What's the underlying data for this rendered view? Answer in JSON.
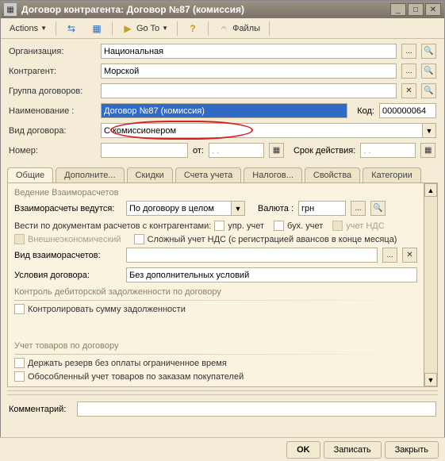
{
  "window": {
    "title": "Договор контрагента: Договор №87 (комиссия)"
  },
  "toolbar": {
    "actions": "Actions",
    "goto": "Go To",
    "files": "Файлы"
  },
  "form": {
    "org_label": "Организация:",
    "org_value": "Национальная",
    "counterparty_label": "Контрагент:",
    "counterparty_value": "Морской",
    "group_label": "Группа договоров:",
    "group_value": "",
    "name_label": "Наименование :",
    "name_value": "Договор №87 (комиссия)",
    "code_label": "Код:",
    "code_value": "000000064",
    "type_label": "Вид договора:",
    "type_value": "С комиссионером",
    "number_label": "Номер:",
    "number_value": "",
    "from_label": "от:",
    "from_value": ". .    ",
    "validity_label": "Срок действия:",
    "validity_value": ". .    "
  },
  "tabs": {
    "t1": "Общие",
    "t2": "Дополните...",
    "t3": "Скидки",
    "t4": "Счета учета",
    "t5": "Налогов...",
    "t6": "Свойства",
    "t7": "Категории"
  },
  "general": {
    "sec1": "ведение взаиморасчетов",
    "mutual_label": "Взаиморасчеты ведутся:",
    "mutual_value": "По договору в целом",
    "currency_label": "Валюта :",
    "currency_value": "грн",
    "docline": "Вести по документам расчетов с контрагентами:",
    "upr": "упр. учет",
    "buh": "бух. учет",
    "nds": "учет НДС",
    "foreign": "Внешнеэкономический",
    "complex_nds": "Сложный  учет НДС (с регистрацией авансов в конце месяца)",
    "kind_label": "Вид взаиморасчетов:",
    "kind_value": "",
    "cond_label": "Условия договора:",
    "cond_value": "Без дополнительных условий",
    "sec2": "Контроль дебиторской задолженности по договору",
    "control_debt": "Контролировать сумму задолженности",
    "sec3": "Учет товаров по договору",
    "reserve": "Держать резерв без оплаты ограниченное время",
    "separate": "Обособленный учет товаров по заказам покупателей"
  },
  "comment_label": "Комментарий:",
  "comment_value": "",
  "footer": {
    "ok": "OK",
    "save": "Записать",
    "close": "Закрыть"
  }
}
